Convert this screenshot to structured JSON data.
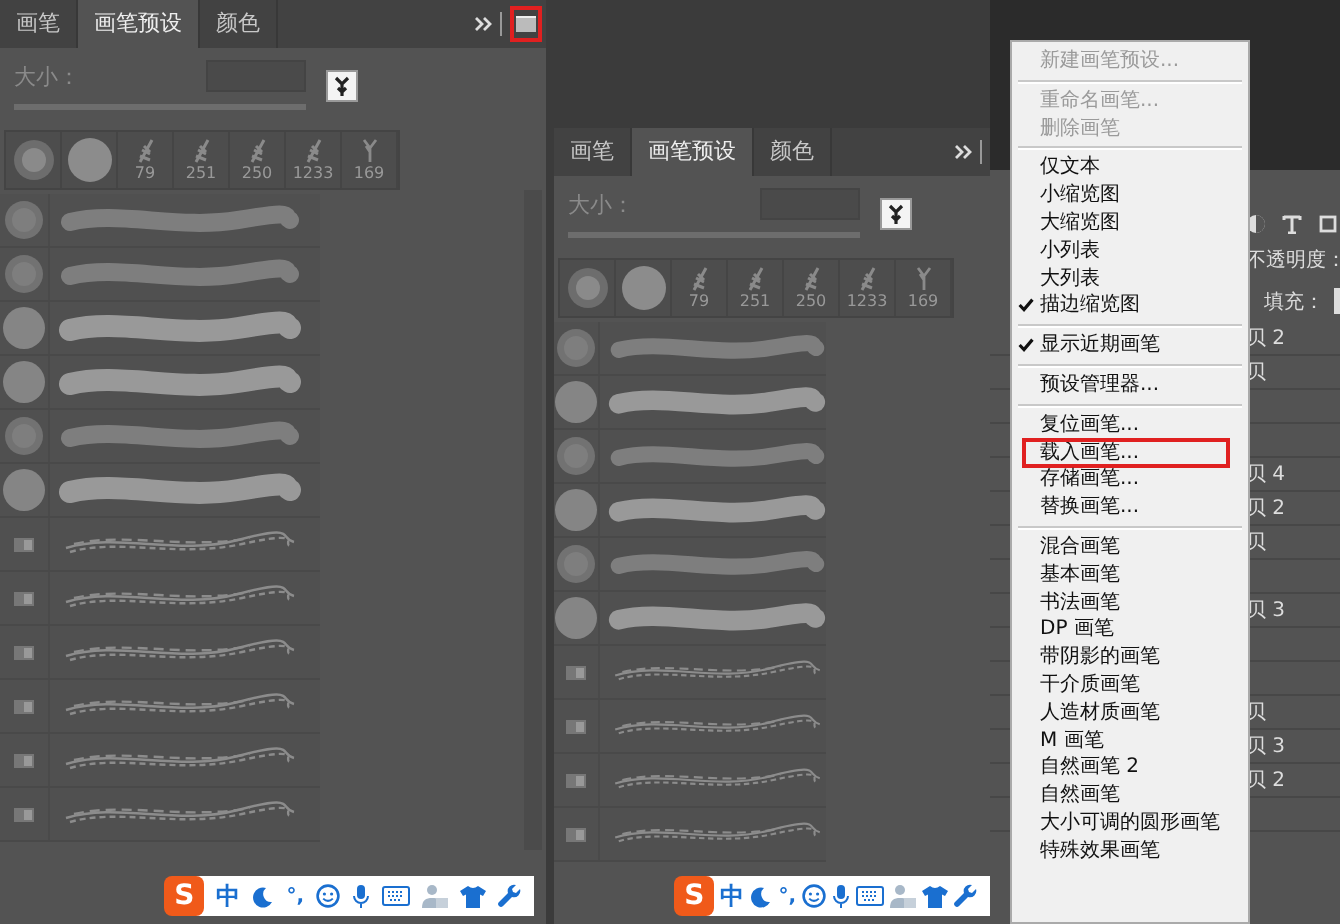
{
  "panels": [
    {
      "tabs": [
        {
          "label": "画笔",
          "selected": false
        },
        {
          "label": "画笔预设",
          "selected": true
        },
        {
          "label": "颜色",
          "selected": false
        }
      ],
      "menu_button": {
        "highlighted": true
      },
      "size_label": "大小：",
      "size_slider": {
        "level": 1
      },
      "presets": [
        {
          "kind": "soft"
        },
        {
          "kind": "hard"
        },
        {
          "kind": "leaf",
          "label": "79"
        },
        {
          "kind": "leaf",
          "label": "251"
        },
        {
          "kind": "leaf",
          "label": "250"
        },
        {
          "kind": "leaf",
          "label": "1233"
        },
        {
          "kind": "grass",
          "label": "169"
        }
      ],
      "brushes": [
        {
          "kind": "soft"
        },
        {
          "kind": "soft"
        },
        {
          "kind": "hard"
        },
        {
          "kind": "hard"
        },
        {
          "kind": "soft"
        },
        {
          "kind": "hard"
        },
        {
          "kind": "texture"
        },
        {
          "kind": "texture"
        },
        {
          "kind": "texture"
        },
        {
          "kind": "texture"
        },
        {
          "kind": "texture"
        },
        {
          "kind": "texture"
        }
      ],
      "ime": {
        "logo": "S",
        "mode": "中",
        "punctuation": "°,"
      }
    },
    {
      "tabs": [
        {
          "label": "画笔",
          "selected": false
        },
        {
          "label": "画笔预设",
          "selected": true
        },
        {
          "label": "颜色",
          "selected": false
        }
      ],
      "size_label": "大小：",
      "size_slider": {
        "level": 1
      },
      "presets": [
        {
          "kind": "soft"
        },
        {
          "kind": "hard"
        },
        {
          "kind": "leaf",
          "label": "79"
        },
        {
          "kind": "leaf",
          "label": "251"
        },
        {
          "kind": "leaf",
          "label": "250"
        },
        {
          "kind": "leaf",
          "label": "1233"
        },
        {
          "kind": "grass",
          "label": "169"
        }
      ],
      "brushes": [
        {
          "kind": "soft"
        },
        {
          "kind": "hard"
        },
        {
          "kind": "soft"
        },
        {
          "kind": "hard"
        },
        {
          "kind": "soft"
        },
        {
          "kind": "hard"
        },
        {
          "kind": "texture"
        },
        {
          "kind": "texture"
        },
        {
          "kind": "texture"
        },
        {
          "kind": "texture"
        }
      ],
      "ime": {
        "logo": "S",
        "mode": "中",
        "punctuation": "°,"
      }
    }
  ],
  "layers_panel": {
    "opacity_label": "不透明度：",
    "fill_label": "填充：",
    "layers": [
      {
        "kind": "named",
        "name": "贝 2"
      },
      {
        "kind": "named",
        "name": "贝"
      },
      {
        "kind": "covered"
      },
      {
        "kind": "covered"
      },
      {
        "kind": "named",
        "name": "贝 4"
      },
      {
        "kind": "named",
        "name": "贝 2"
      },
      {
        "kind": "named",
        "name": "贝"
      },
      {
        "kind": "covered"
      },
      {
        "kind": "named",
        "name": "贝 3"
      },
      {
        "kind": "covered"
      },
      {
        "kind": "covered"
      },
      {
        "kind": "named",
        "name": "贝"
      },
      {
        "kind": "named",
        "name": "贝 3"
      },
      {
        "kind": "named",
        "name": "贝 2"
      },
      {
        "kind": "covered"
      }
    ]
  },
  "menu": [
    {
      "kind": "item",
      "label": "新建画笔预设...",
      "disabled": true,
      "checked": false,
      "highlighted": false
    },
    {
      "kind": "separator"
    },
    {
      "kind": "item",
      "label": "重命名画笔...",
      "disabled": true,
      "checked": false,
      "highlighted": false
    },
    {
      "kind": "item",
      "label": "删除画笔",
      "disabled": true,
      "checked": false,
      "highlighted": false
    },
    {
      "kind": "separator"
    },
    {
      "kind": "item",
      "label": "仅文本",
      "disabled": false,
      "checked": false,
      "highlighted": false
    },
    {
      "kind": "item",
      "label": "小缩览图",
      "disabled": false,
      "checked": false,
      "highlighted": false
    },
    {
      "kind": "item",
      "label": "大缩览图",
      "disabled": false,
      "checked": false,
      "highlighted": false
    },
    {
      "kind": "item",
      "label": "小列表",
      "disabled": false,
      "checked": false,
      "highlighted": false
    },
    {
      "kind": "item",
      "label": "大列表",
      "disabled": false,
      "checked": false,
      "highlighted": false
    },
    {
      "kind": "item",
      "label": "描边缩览图",
      "disabled": false,
      "checked": true,
      "highlighted": false
    },
    {
      "kind": "separator"
    },
    {
      "kind": "item",
      "label": "显示近期画笔",
      "disabled": false,
      "checked": true,
      "highlighted": false
    },
    {
      "kind": "separator"
    },
    {
      "kind": "item",
      "label": "预设管理器...",
      "disabled": false,
      "checked": false,
      "highlighted": false
    },
    {
      "kind": "separator"
    },
    {
      "kind": "item",
      "label": "复位画笔...",
      "disabled": false,
      "checked": false,
      "highlighted": false
    },
    {
      "kind": "item",
      "label": "载入画笔...",
      "disabled": false,
      "checked": false,
      "highlighted": true
    },
    {
      "kind": "item",
      "label": "存储画笔...",
      "disabled": false,
      "checked": false,
      "highlighted": false
    },
    {
      "kind": "item",
      "label": "替换画笔...",
      "disabled": false,
      "checked": false,
      "highlighted": false
    },
    {
      "kind": "separator"
    },
    {
      "kind": "item",
      "label": "混合画笔",
      "disabled": false,
      "checked": false,
      "highlighted": false
    },
    {
      "kind": "item",
      "label": "基本画笔",
      "disabled": false,
      "checked": false,
      "highlighted": false
    },
    {
      "kind": "item",
      "label": "书法画笔",
      "disabled": false,
      "checked": false,
      "highlighted": false
    },
    {
      "kind": "item",
      "label": "DP 画笔",
      "disabled": false,
      "checked": false,
      "highlighted": false
    },
    {
      "kind": "item",
      "label": "带阴影的画笔",
      "disabled": false,
      "checked": false,
      "highlighted": false
    },
    {
      "kind": "item",
      "label": "干介质画笔",
      "disabled": false,
      "checked": false,
      "highlighted": false
    },
    {
      "kind": "item",
      "label": "人造材质画笔",
      "disabled": false,
      "checked": false,
      "highlighted": false
    },
    {
      "kind": "item",
      "label": "M 画笔",
      "disabled": false,
      "checked": false,
      "highlighted": false
    },
    {
      "kind": "item",
      "label": "自然画笔 2",
      "disabled": false,
      "checked": false,
      "highlighted": false
    },
    {
      "kind": "item",
      "label": "自然画笔",
      "disabled": false,
      "checked": false,
      "highlighted": false
    },
    {
      "kind": "item",
      "label": "大小可调的圆形画笔",
      "disabled": false,
      "checked": false,
      "highlighted": false
    },
    {
      "kind": "item",
      "label": "特殊效果画笔",
      "disabled": false,
      "checked": false,
      "highlighted": false
    }
  ]
}
